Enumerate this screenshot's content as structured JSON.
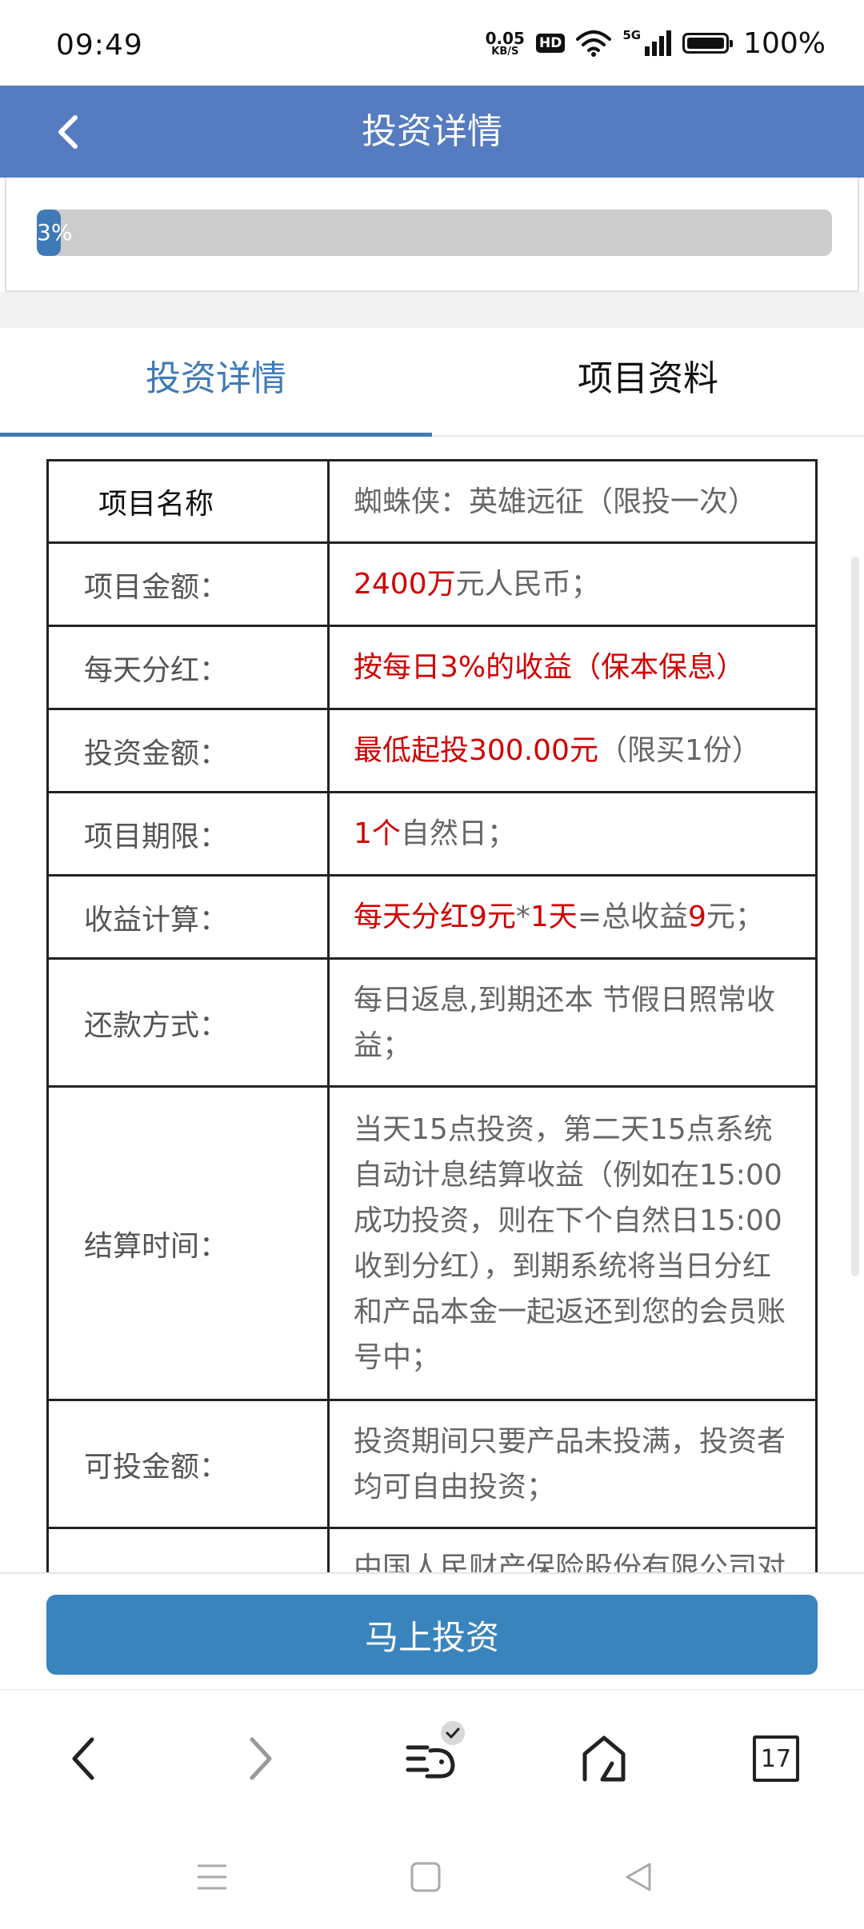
{
  "status_bar": {
    "time": "09:49",
    "net_speed_value": "0.05",
    "net_speed_unit": "KB/S",
    "hd_label": "HD",
    "net_type": "5G",
    "battery": "100%"
  },
  "header": {
    "title": "投资详情",
    "back_icon": "chevron-left-icon"
  },
  "progress": {
    "percent": 3,
    "label": "3%"
  },
  "tabs": [
    {
      "label": "投资详情",
      "active": true
    },
    {
      "label": "项目资料",
      "active": false
    }
  ],
  "details": {
    "rows": [
      {
        "label": "项目名称",
        "value": "蜘蛛侠：英雄远征（限投一次）"
      },
      {
        "label": "项目金额：",
        "value_red": "2400万",
        "value_rest": "元人民币；"
      },
      {
        "label": "每天分红：",
        "value_red": "按每日3%的收益（保本保息）"
      },
      {
        "label": "投资金额：",
        "value_red": "最低起投300.00元",
        "value_rest": "（限买1份）"
      },
      {
        "label": "项目期限：",
        "value_red": "1个",
        "value_rest": "自然日；"
      },
      {
        "label": "收益计算：",
        "parts": [
          "每天分红9元",
          "*",
          "1天",
          "=总收益",
          "9",
          "元；"
        ]
      },
      {
        "label": "还款方式：",
        "value": "每日返息,到期还本 节假日照常收益；"
      },
      {
        "label": "结算时间：",
        "value": "当天15点投资，第二天15点系统自动计息结算收益（例如在15:00成功投资，则在下个自然日15:00收到分红），到期系统将当日分红和产品本金一起返还到您的会员账号中；"
      },
      {
        "label": "可投金额：",
        "value": "投资期间只要产品未投满，投资者均可自由投资；"
      },
      {
        "label": "",
        "value": "中国人民财产保险股份有限公司对"
      }
    ]
  },
  "action": {
    "invest_label": "马上投资"
  },
  "browser_bar": {
    "tab_count": "17"
  },
  "colors": {
    "header_bg": "#557bc0",
    "accent": "#3f7ab7",
    "button": "#3a84bd",
    "highlight_red": "#d00000"
  }
}
